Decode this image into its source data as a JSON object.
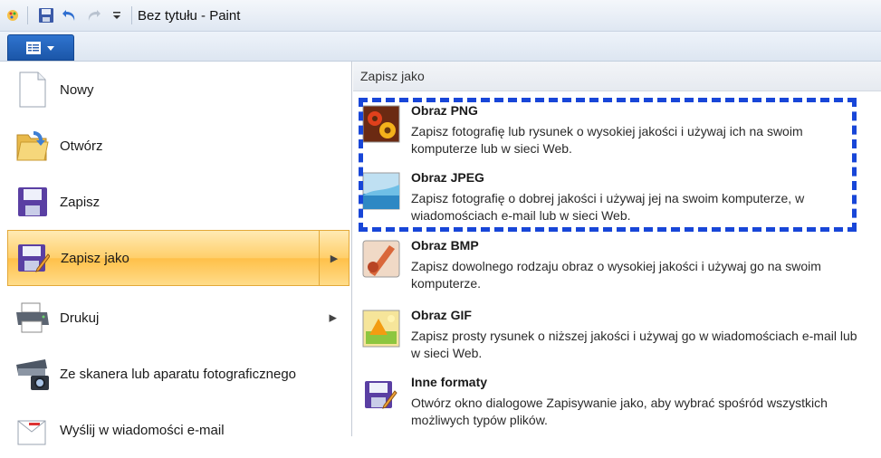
{
  "window": {
    "title": "Bez tytułu - Paint"
  },
  "icons": {
    "paint": "paint-app-icon",
    "save": "floppy-disk-icon",
    "undo": "undo-arrow-icon",
    "redo": "redo-arrow-icon",
    "customize": "dropdown-small-icon"
  },
  "menu": {
    "items": [
      {
        "label": "Nowy"
      },
      {
        "label": "Otwórz"
      },
      {
        "label": "Zapisz"
      },
      {
        "label": "Zapisz jako"
      },
      {
        "label": "Drukuj"
      },
      {
        "label": "Ze skanera lub aparatu fotograficznego"
      },
      {
        "label": "Wyślij w wiadomości e-mail"
      }
    ]
  },
  "save_as": {
    "header": "Zapisz jako",
    "formats": [
      {
        "title": "Obraz PNG",
        "desc": "Zapisz fotografię lub rysunek o wysokiej jakości i używaj ich na swoim komputerze lub w sieci Web."
      },
      {
        "title": "Obraz JPEG",
        "desc": "Zapisz fotografię o dobrej jakości i używaj jej na swoim komputerze, w wiadomościach e-mail lub w sieci Web."
      },
      {
        "title": "Obraz BMP",
        "desc": "Zapisz dowolnego rodzaju obraz o wysokiej jakości i używaj go na swoim komputerze."
      },
      {
        "title": "Obraz GIF",
        "desc": "Zapisz prosty rysunek o niższej jakości i używaj go w wiadomościach e-mail lub w sieci Web."
      },
      {
        "title": "Inne formaty",
        "desc": "Otwórz okno dialogowe Zapisywanie jako, aby wybrać spośród wszystkich możliwych typów plików."
      }
    ]
  },
  "colors": {
    "highlight": "#1846d8",
    "active_menu": "#ffc049",
    "ribbon_button": "#1b56a8"
  }
}
